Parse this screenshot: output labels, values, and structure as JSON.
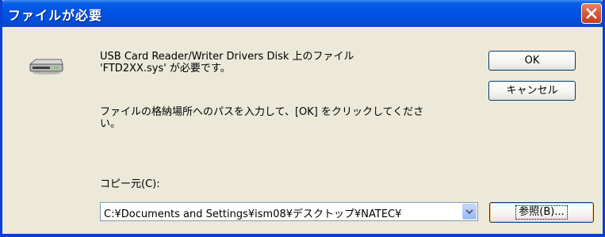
{
  "window": {
    "title": "ファイルが必要",
    "icons": {
      "close": "close-icon",
      "drive": "disk-drive-icon",
      "dropdown": "chevron-down-icon"
    }
  },
  "message": {
    "line1": "USB Card Reader/Writer Drivers Disk 上のファイル\n'FTD2XX.sys' が必要です。",
    "line2": "ファイルの格納場所へのパスを入力して、[OK] をクリックしてくださ\nい。"
  },
  "buttons": {
    "ok_label": "OK",
    "cancel_label": "キャンセル",
    "browse_label": "参照(B)..."
  },
  "copy_from": {
    "label": "コピー元(C):",
    "value": "C:¥Documents and Settings¥ism08¥デスクトップ¥NATEC¥"
  },
  "colors": {
    "titlebar": "#0054e3",
    "frame": "#0a3fd6",
    "dialog_bg": "#ece9d8",
    "close_button": "#d55a3c"
  }
}
